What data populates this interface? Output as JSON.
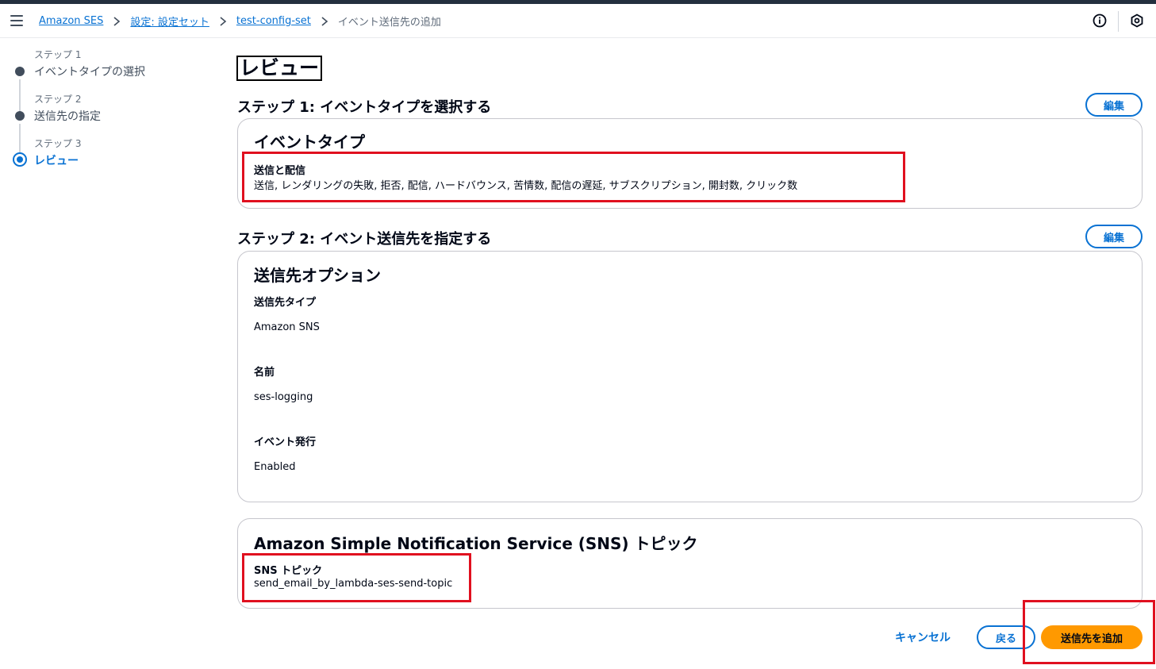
{
  "header": {
    "breadcrumbs": [
      "Amazon SES",
      "設定: 設定セット",
      "test-config-set"
    ],
    "current": "イベント送信先の追加"
  },
  "steps": [
    {
      "sub": "ステップ 1",
      "title": "イベントタイプの選択"
    },
    {
      "sub": "ステップ 2",
      "title": "送信先の指定"
    },
    {
      "sub": "ステップ 3",
      "title": "レビュー"
    }
  ],
  "page_title": "レビュー",
  "step1": {
    "heading": "ステップ 1: イベントタイプを選択する",
    "edit": "編集",
    "card_title": "イベントタイプ",
    "label": "送信と配信",
    "value": "送信, レンダリングの失敗, 拒否, 配信, ハードバウンス, 苦情数, 配信の遅延, サブスクリプション, 開封数, クリック数"
  },
  "step2": {
    "heading": "ステップ 2: イベント送信先を指定する",
    "edit": "編集",
    "card_title": "送信先オプション",
    "fields": [
      {
        "label": "送信先タイプ",
        "value": "Amazon SNS"
      },
      {
        "label": "名前",
        "value": "ses-logging"
      },
      {
        "label": "イベント発行",
        "value": "Enabled"
      }
    ]
  },
  "sns": {
    "card_title": "Amazon Simple Notification Service (SNS) トピック",
    "label": "SNS トピック",
    "value": "send_email_by_lambda-ses-send-topic"
  },
  "footer": {
    "cancel": "キャンセル",
    "back": "戻る",
    "submit": "送信先を追加"
  },
  "colors": {
    "accent": "#0972d3",
    "primary_button": "#ff9900",
    "highlight": "#e0101f"
  }
}
